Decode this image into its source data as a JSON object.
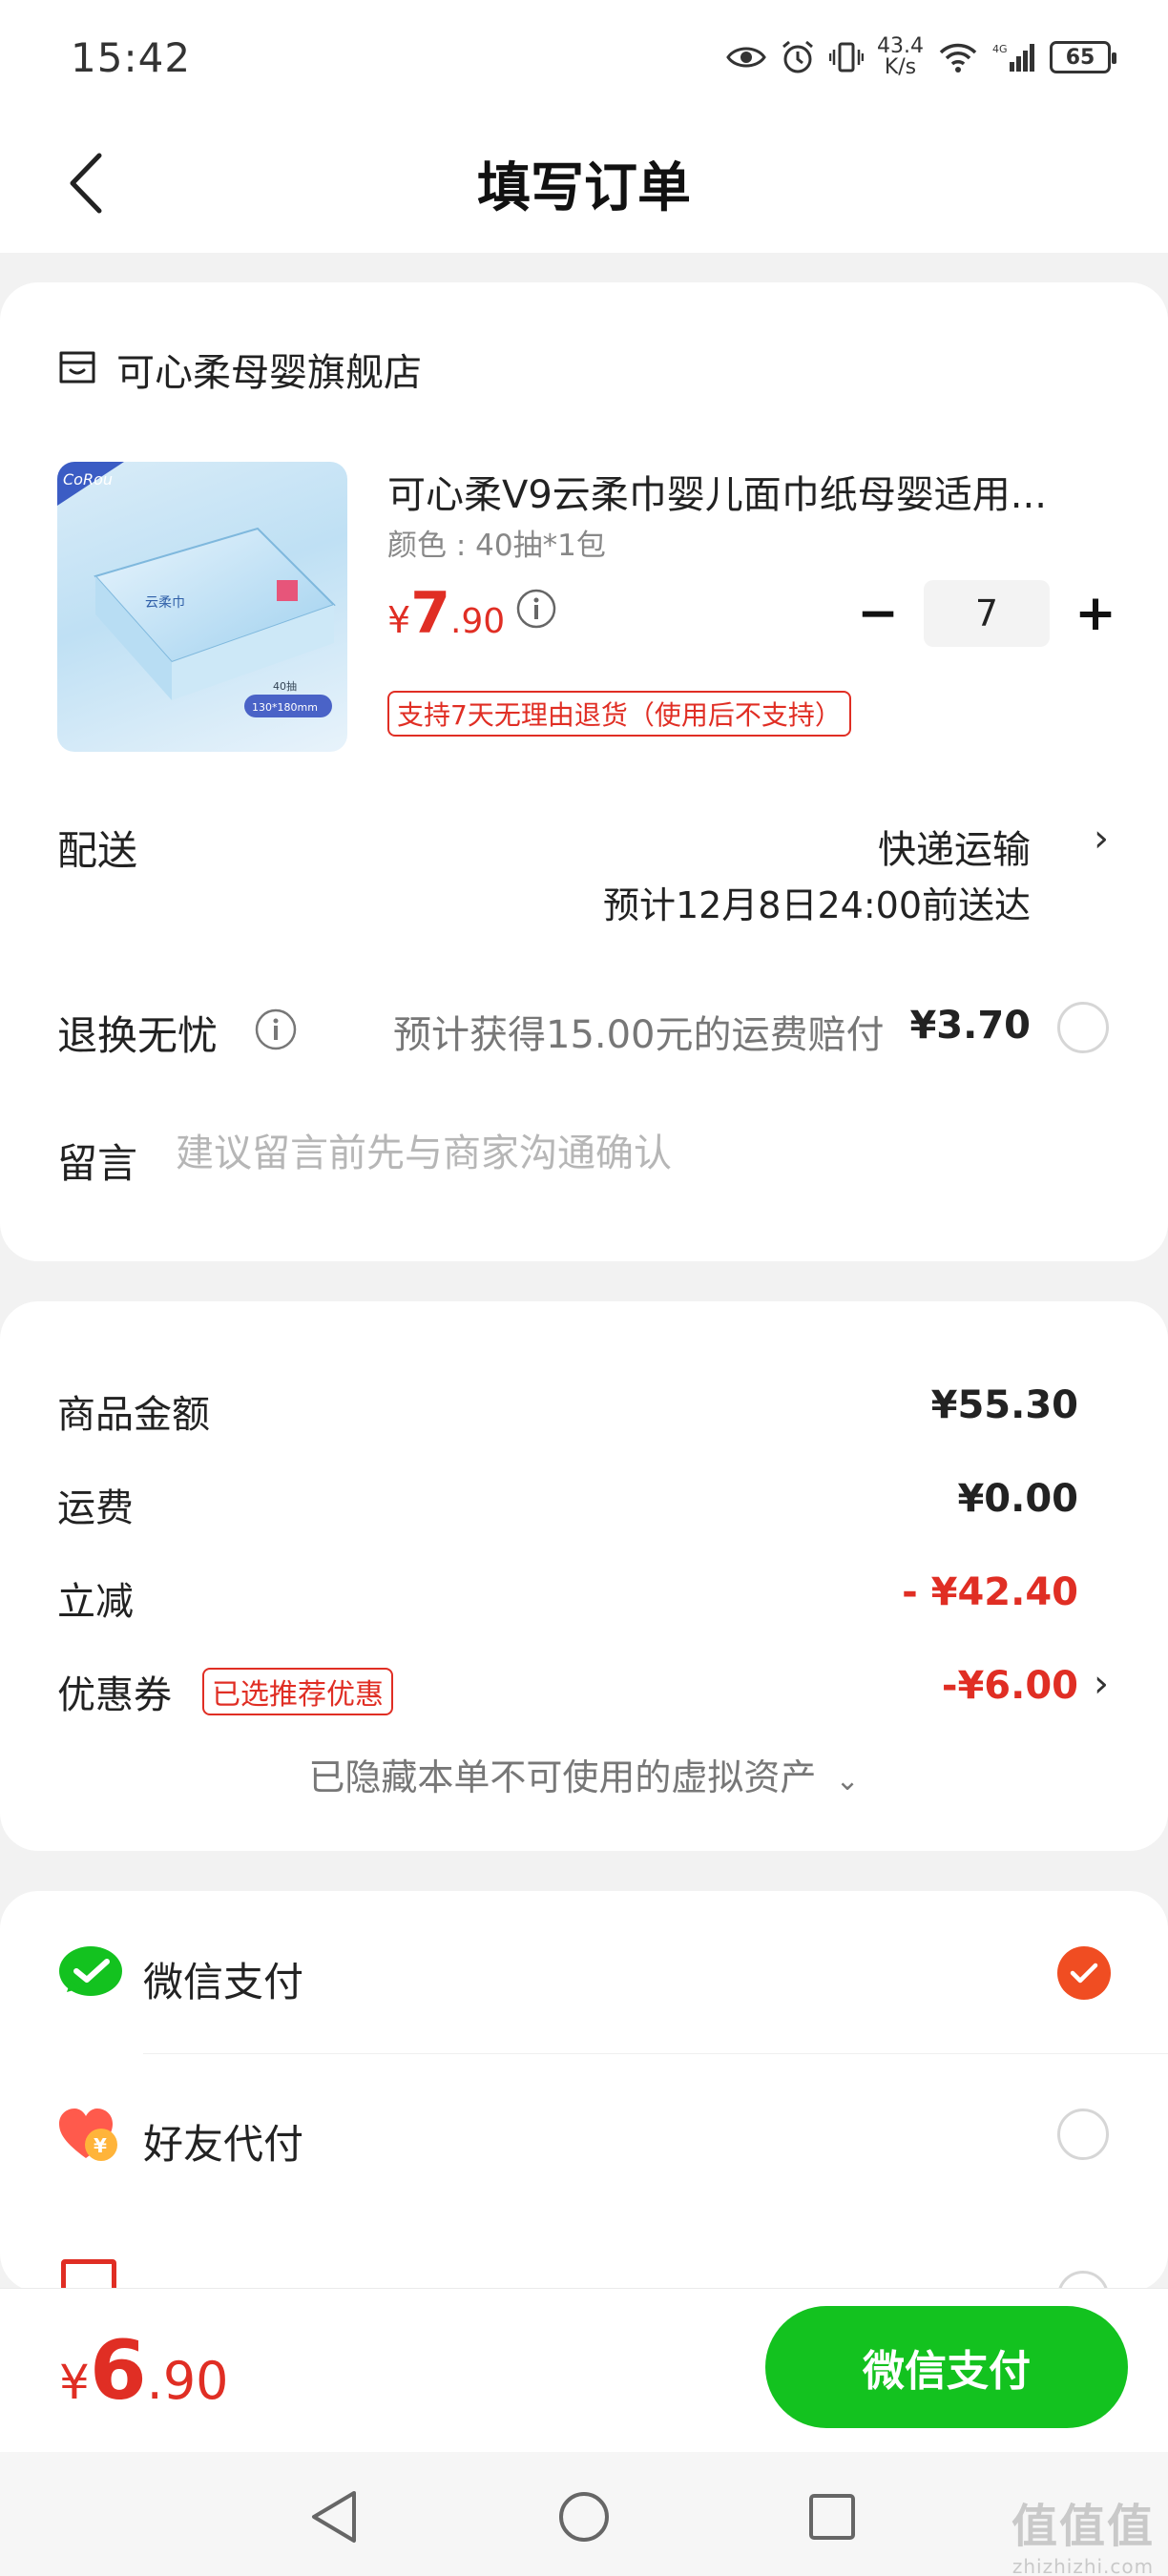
{
  "status_bar": {
    "time": "15:42",
    "net_speed_value": "43.4",
    "net_speed_unit": "K/s",
    "battery": "65",
    "signal_label": "4G"
  },
  "header": {
    "title": "填写订单",
    "back_icon": "chevron-left-icon"
  },
  "shop": {
    "name": "可心柔母婴旗舰店",
    "icon": "store-icon"
  },
  "product": {
    "title": "可心柔V9云柔巾婴儿面巾纸母婴适用...",
    "spec": "颜色 : 40抽*1包",
    "price_symbol": "¥",
    "price_integer": "7",
    "price_decimal": ".90",
    "quantity": "7",
    "minus_label": "−",
    "plus_label": "+",
    "return_policy": "支持7天无理由退货（使用后不支持）",
    "image_text": {
      "brand": "CoRou",
      "name": "云柔巾",
      "count": "40抽",
      "size": "130*180mm"
    }
  },
  "delivery": {
    "label": "配送",
    "method": "快递运输",
    "eta": "预计12月8日24:00前送达"
  },
  "return_worry": {
    "label": "退换无忧",
    "desc": "预计获得15.00元的运费赔付",
    "price": "¥3.70"
  },
  "message": {
    "label": "留言",
    "placeholder": "建议留言前先与商家沟通确认"
  },
  "summary": {
    "items": [
      {
        "label": "商品金额",
        "value": "¥55.30"
      },
      {
        "label": "运费",
        "value": "¥0.00"
      },
      {
        "label": "立减",
        "value": "- ¥42.40"
      },
      {
        "label": "优惠券",
        "value": "-¥6.00"
      }
    ],
    "coupon_badge": "已选推荐优惠",
    "hidden_assets": "已隐藏本单不可使用的虚拟资产"
  },
  "payment": {
    "methods": [
      {
        "label": "微信支付",
        "icon": "wechat-pay-icon",
        "selected": true
      },
      {
        "label": "好友代付",
        "icon": "friend-pay-icon",
        "selected": false
      }
    ]
  },
  "footer": {
    "total_symbol": "¥",
    "total_integer": "6",
    "total_decimal": ".90",
    "pay_button": "微信支付"
  },
  "watermark": {
    "logo": "值值值",
    "url": "zhizhizhi.com"
  },
  "colors": {
    "price_red": "#e02e24",
    "wechat_green": "#13c21f",
    "check_orange": "#f04d22"
  }
}
